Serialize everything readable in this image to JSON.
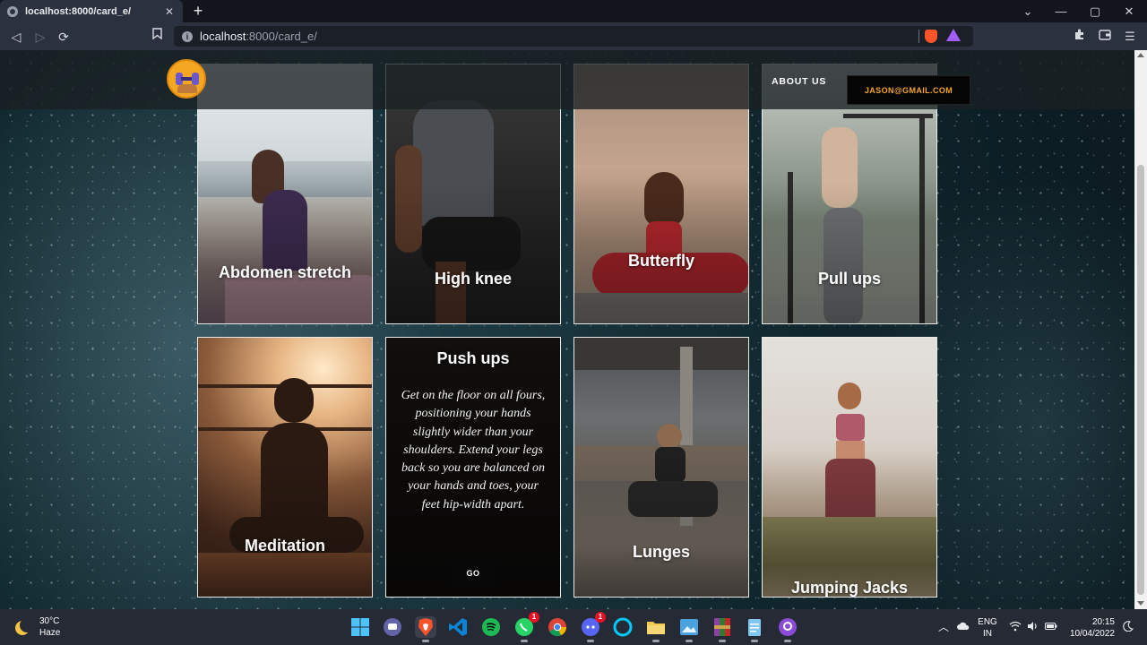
{
  "browser": {
    "tab_title": "localhost:8000/card_e/",
    "tab_close": "✕",
    "new_tab": "+",
    "url_host": "localhost",
    "url_path": ":8000/card_e/",
    "window_controls": {
      "tabs_menu": "⌄",
      "minimize": "—",
      "maximize": "▢",
      "close": "✕"
    },
    "nav": {
      "back": "◁",
      "forward": "▷",
      "reload": "⟳",
      "bookmark": "🔖"
    },
    "icons": {
      "extensions": "puzzle-icon",
      "wallet": "wallet-icon",
      "menu": "☰"
    }
  },
  "site": {
    "nav": {
      "about": "ABOUT US",
      "email": "JASON@GMAIL.COM"
    },
    "cards": [
      {
        "label": "Abdomen stretch"
      },
      {
        "label": "High knee"
      },
      {
        "label": "Butterfly"
      },
      {
        "label": "Pull ups"
      },
      {
        "label": "Meditation"
      },
      {
        "label": "Push ups",
        "description": "Get on the floor on all fours, positioning your hands slightly wider than your shoulders. Extend your legs back so you are balanced on your hands and toes, your feet hip-width apart.",
        "button": "GO"
      },
      {
        "label": "Lunges"
      },
      {
        "label": "Jumping Jacks"
      }
    ]
  },
  "taskbar": {
    "weather": {
      "temp": "30°C",
      "condition": "Haze"
    },
    "badges": {
      "whatsapp": "1",
      "discord": "1"
    },
    "language": {
      "line1": "ENG",
      "line2": "IN"
    },
    "clock": {
      "time": "20:15",
      "date": "10/04/2022"
    }
  }
}
